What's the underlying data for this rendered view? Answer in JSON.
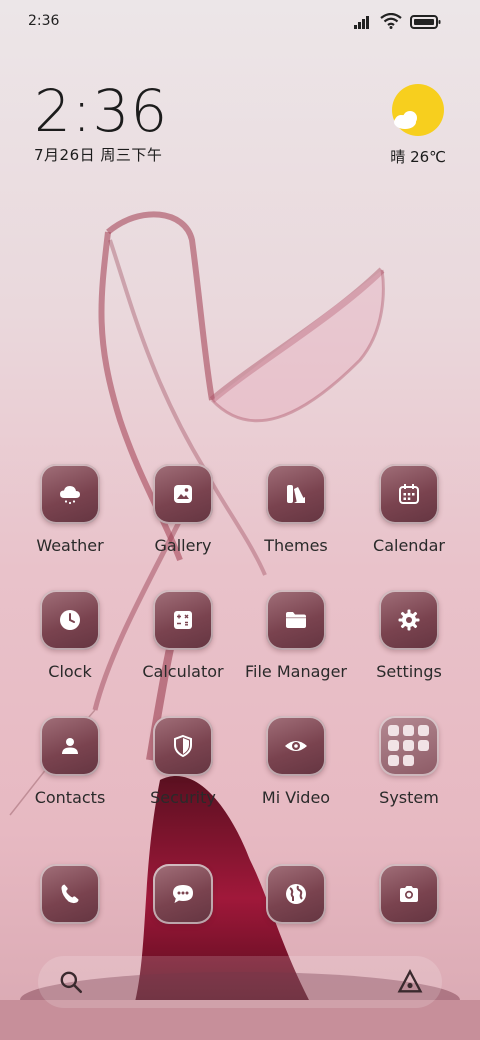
{
  "status_bar": {
    "time": "2:36",
    "icons": [
      "signal-icon",
      "wifi-icon",
      "battery-icon"
    ]
  },
  "clock_widget": {
    "time": "2:36",
    "date": "7月26日 周三下午"
  },
  "weather_widget": {
    "icon": "sun-cloud-icon",
    "text": "晴 26℃"
  },
  "apps": [
    {
      "label": "Weather",
      "icon": "weather-icon"
    },
    {
      "label": "Gallery",
      "icon": "gallery-icon"
    },
    {
      "label": "Themes",
      "icon": "themes-icon"
    },
    {
      "label": "Calendar",
      "icon": "calendar-icon"
    },
    {
      "label": "Clock",
      "icon": "clock-icon"
    },
    {
      "label": "Calculator",
      "icon": "calculator-icon"
    },
    {
      "label": "File Manager",
      "icon": "folder-icon"
    },
    {
      "label": "Settings",
      "icon": "gear-icon"
    },
    {
      "label": "Contacts",
      "icon": "contacts-icon"
    },
    {
      "label": "Security",
      "icon": "shield-icon"
    },
    {
      "label": "Mi Video",
      "icon": "eye-icon"
    },
    {
      "label": "System",
      "icon": "folder-grid-icon"
    }
  ],
  "dock": [
    {
      "icon": "phone-icon"
    },
    {
      "icon": "message-icon"
    },
    {
      "icon": "globe-icon"
    },
    {
      "icon": "camera-icon"
    }
  ],
  "search_bar": {
    "icons": [
      "search-icon",
      "assistant-icon"
    ]
  },
  "colors": {
    "icon_tile": "#7a434f",
    "sun": "#f7cf1e"
  }
}
